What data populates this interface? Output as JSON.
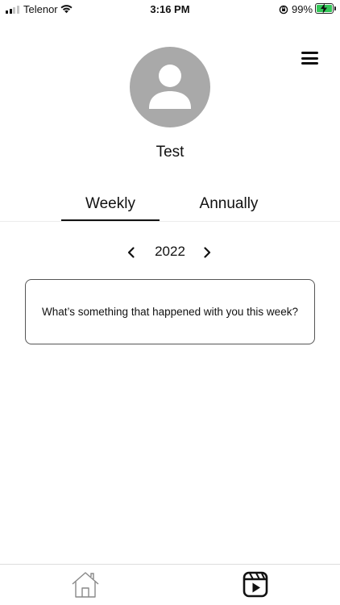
{
  "status_bar": {
    "carrier": "Telenor",
    "time": "3:16 PM",
    "battery_percent": "99%",
    "battery_level": 0.99,
    "charging": true,
    "signal_bars_filled": 2,
    "signal_bars_total": 4
  },
  "header": {
    "menu_icon": "hamburger-menu-icon"
  },
  "profile": {
    "avatar_icon": "user-avatar-icon",
    "name": "Test"
  },
  "tabs": [
    {
      "label": "Weekly",
      "active": true
    },
    {
      "label": "Annually",
      "active": false
    }
  ],
  "year_selector": {
    "year": "2022",
    "prev_icon": "chevron-left-icon",
    "next_icon": "chevron-right-icon"
  },
  "prompt": {
    "text": "What’s something that happened with you this week?"
  },
  "bottom_nav": {
    "items": [
      {
        "icon": "home-icon"
      },
      {
        "icon": "reels-icon",
        "active": true
      }
    ]
  },
  "colors": {
    "accent": "#111111",
    "avatar_bg": "#a9a9a9",
    "battery_green": "#34c759",
    "signal_inactive": "#c4c4c4"
  }
}
